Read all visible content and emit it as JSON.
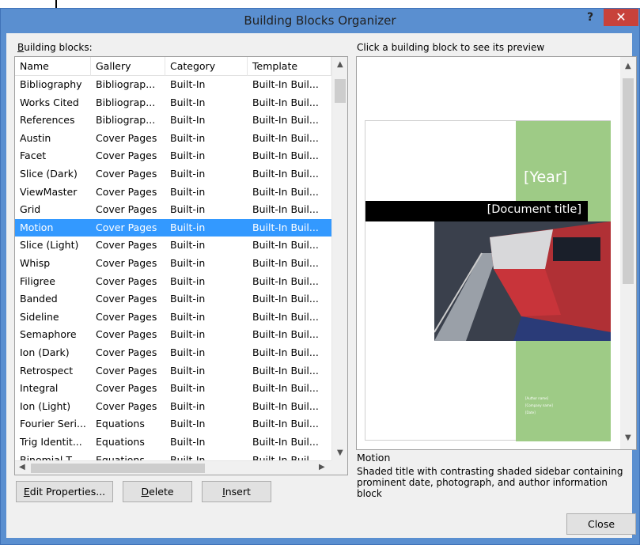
{
  "window": {
    "title": "Building Blocks Organizer",
    "help_label": "?",
    "close_glyph": "✕"
  },
  "list": {
    "label_accel": "B",
    "label_rest": "uilding blocks:",
    "columns": [
      "Name",
      "Gallery",
      "Category",
      "Template"
    ],
    "rows": [
      [
        "Bibliography",
        "Bibliograp...",
        "Built-In",
        "Built-In Buil..."
      ],
      [
        "Works Cited",
        "Bibliograp...",
        "Built-In",
        "Built-In Buil..."
      ],
      [
        "References",
        "Bibliograp...",
        "Built-In",
        "Built-In Buil..."
      ],
      [
        "Austin",
        "Cover Pages",
        "Built-in",
        "Built-In Buil..."
      ],
      [
        "Facet",
        "Cover Pages",
        "Built-in",
        "Built-In Buil..."
      ],
      [
        "Slice (Dark)",
        "Cover Pages",
        "Built-in",
        "Built-In Buil..."
      ],
      [
        "ViewMaster",
        "Cover Pages",
        "Built-in",
        "Built-In Buil..."
      ],
      [
        "Grid",
        "Cover Pages",
        "Built-in",
        "Built-In Buil..."
      ],
      [
        "Motion",
        "Cover Pages",
        "Built-in",
        "Built-In Buil..."
      ],
      [
        "Slice (Light)",
        "Cover Pages",
        "Built-in",
        "Built-In Buil..."
      ],
      [
        "Whisp",
        "Cover Pages",
        "Built-in",
        "Built-In Buil..."
      ],
      [
        "Filigree",
        "Cover Pages",
        "Built-in",
        "Built-In Buil..."
      ],
      [
        "Banded",
        "Cover Pages",
        "Built-in",
        "Built-In Buil..."
      ],
      [
        "Sideline",
        "Cover Pages",
        "Built-in",
        "Built-In Buil..."
      ],
      [
        "Semaphore",
        "Cover Pages",
        "Built-in",
        "Built-In Buil..."
      ],
      [
        "Ion (Dark)",
        "Cover Pages",
        "Built-in",
        "Built-In Buil..."
      ],
      [
        "Retrospect",
        "Cover Pages",
        "Built-in",
        "Built-In Buil..."
      ],
      [
        "Integral",
        "Cover Pages",
        "Built-in",
        "Built-In Buil..."
      ],
      [
        "Ion (Light)",
        "Cover Pages",
        "Built-in",
        "Built-In Buil..."
      ],
      [
        "Fourier Seri...",
        "Equations",
        "Built-In",
        "Built-In Buil..."
      ],
      [
        "Trig Identit...",
        "Equations",
        "Built-In",
        "Built-In Buil..."
      ],
      [
        "Binomial T...",
        "Equations",
        "Built-In",
        "Built-In Buil..."
      ]
    ],
    "selected_index": 8
  },
  "buttons": {
    "edit_accel": "E",
    "edit_rest": "dit Properties...",
    "delete_accel": "D",
    "delete_rest": "elete",
    "insert_accel": "I",
    "insert_rest": "nsert",
    "close": "Close"
  },
  "preview": {
    "heading": "Click a building block to see its preview",
    "year": "[Year]",
    "doc_title": "[Document title]",
    "tiny_fields": [
      "[Author name]",
      "[Company name]",
      "[Date]"
    ],
    "name": "Motion",
    "description": "Shaded title with contrasting shaded sidebar containing prominent date, photograph, and author information block"
  },
  "colors": {
    "titlebar": "#5a8fd0",
    "selection": "#3399ff",
    "sidebar_green": "#9ecb86",
    "close_red": "#c8423b"
  }
}
